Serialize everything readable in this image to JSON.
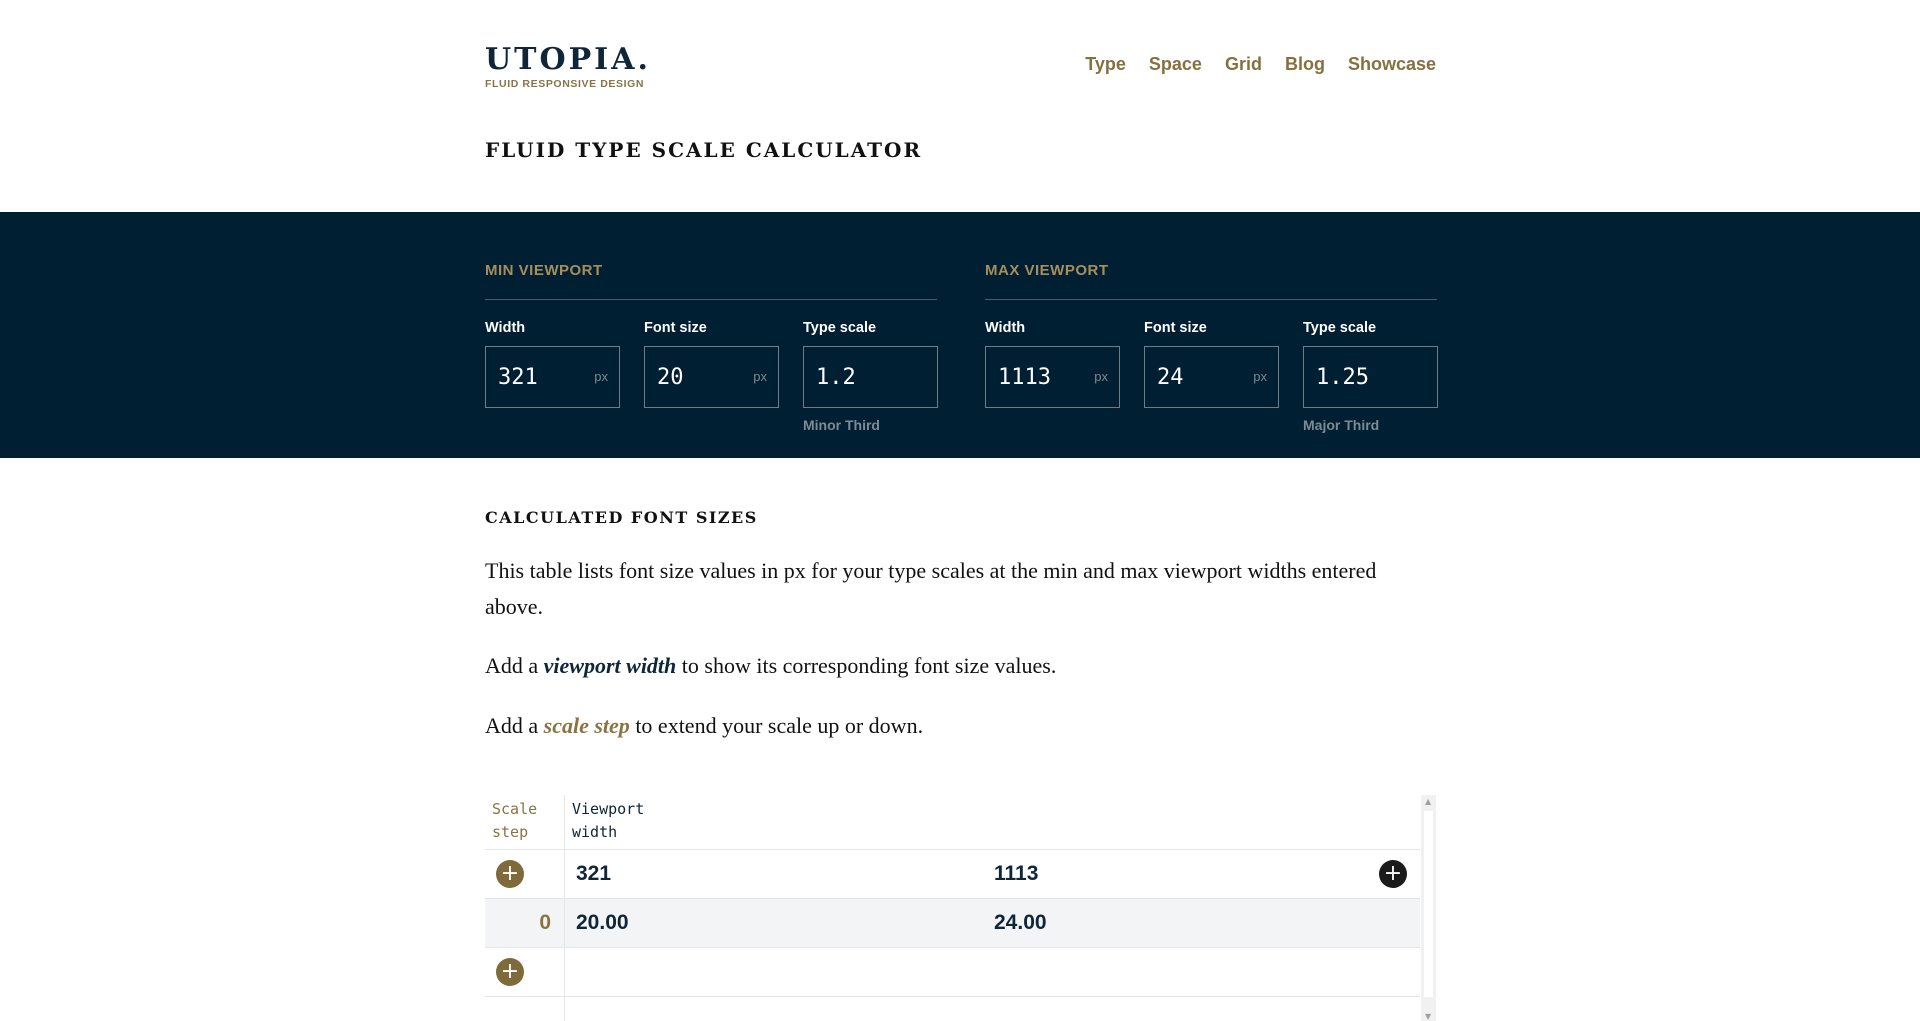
{
  "header": {
    "logo_title": "UTOPIA.",
    "logo_subtitle": "FLUID RESPONSIVE DESIGN",
    "nav": [
      "Type",
      "Space",
      "Grid",
      "Blog",
      "Showcase"
    ]
  },
  "page_title": "FLUID TYPE SCALE CALCULATOR",
  "min_viewport": {
    "heading": "MIN VIEWPORT",
    "width_label": "Width",
    "width_value": "321",
    "width_unit": "px",
    "font_size_label": "Font size",
    "font_size_value": "20",
    "font_size_unit": "px",
    "type_scale_label": "Type scale",
    "type_scale_value": "1.2",
    "type_scale_name": "Minor Third"
  },
  "max_viewport": {
    "heading": "MAX VIEWPORT",
    "width_label": "Width",
    "width_value": "1113",
    "width_unit": "px",
    "font_size_label": "Font size",
    "font_size_value": "24",
    "font_size_unit": "px",
    "type_scale_label": "Type scale",
    "type_scale_value": "1.25",
    "type_scale_name": "Major Third"
  },
  "calculated": {
    "title": "CALCULATED FONT SIZES",
    "intro": "This table lists font size values in px for your type scales at the min and max viewport widths entered above.",
    "add_viewport_prefix": "Add a ",
    "add_viewport_em": "viewport width",
    "add_viewport_suffix": " to show its corresponding font size values.",
    "add_step_prefix": "Add a ",
    "add_step_em": "scale step",
    "add_step_suffix": " to extend your scale up or down."
  },
  "table": {
    "header_scale_step": [
      "Scale",
      "step"
    ],
    "header_viewport_width": [
      "Viewport",
      "width"
    ],
    "viewport_widths": [
      "321",
      "1113"
    ],
    "rows": [
      {
        "step": "0",
        "values": [
          "20.00",
          "24.00"
        ]
      }
    ],
    "add_icon": "+"
  },
  "colors": {
    "navy": "#001f33",
    "gold": "#8b7345"
  }
}
